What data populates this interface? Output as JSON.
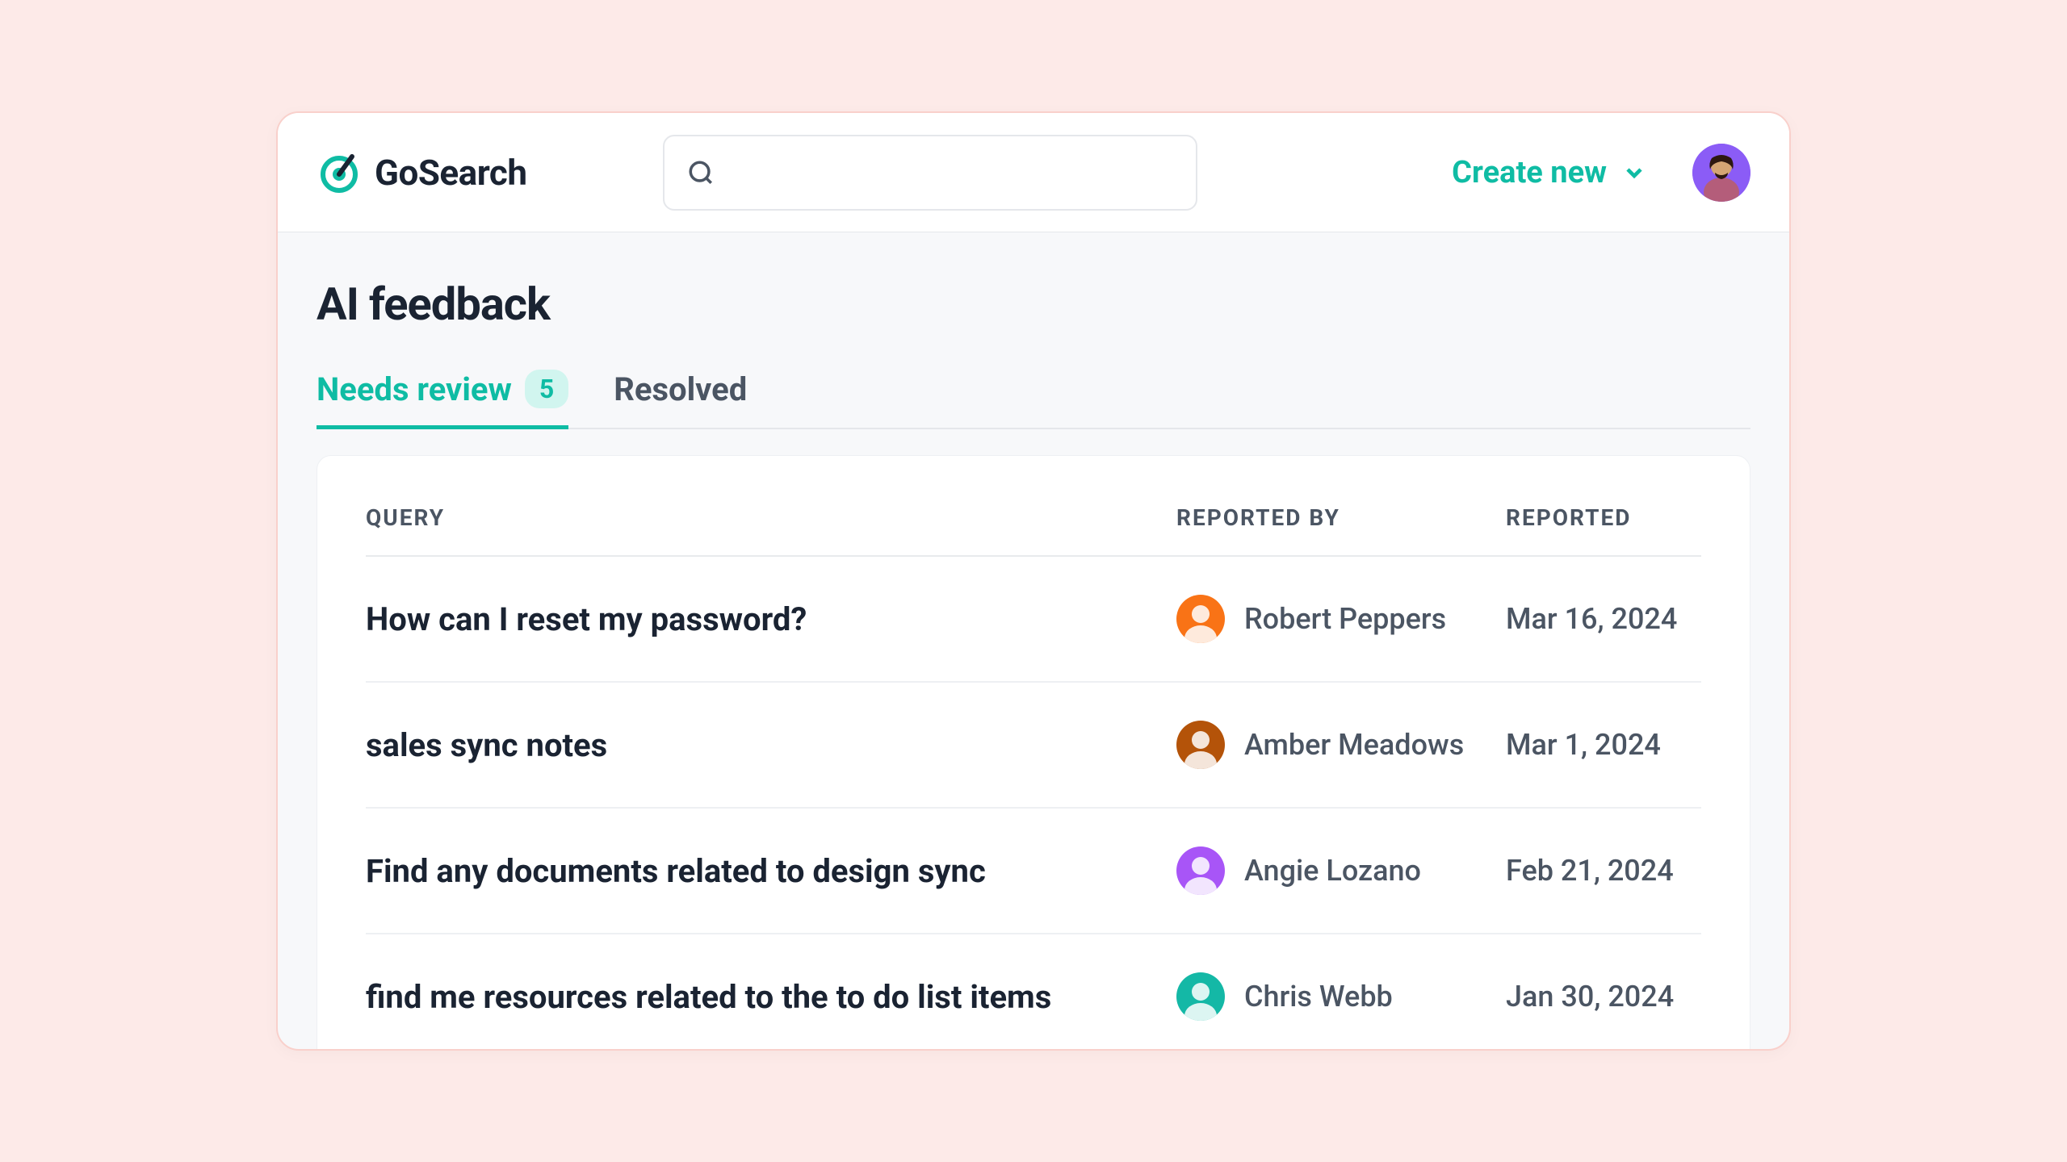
{
  "brand": {
    "name": "GoSearch"
  },
  "header": {
    "create_new_label": "Create new"
  },
  "page": {
    "title": "AI feedback"
  },
  "tabs": {
    "needs_review": {
      "label": "Needs review",
      "count": "5"
    },
    "resolved": {
      "label": "Resolved"
    }
  },
  "table": {
    "columns": {
      "query": "QUERY",
      "reported_by": "REPORTED BY",
      "reported": "REPORTED"
    },
    "rows": [
      {
        "query": "How can I reset my password?",
        "reporter": "Robert Peppers",
        "date": "Mar 16, 2024",
        "avatar_color": "#f97316"
      },
      {
        "query": "sales sync notes",
        "reporter": "Amber Meadows",
        "date": "Mar 1, 2024",
        "avatar_color": "#b45309"
      },
      {
        "query": "Find any documents related to design sync",
        "reporter": "Angie Lozano",
        "date": "Feb 21, 2024",
        "avatar_color": "#a855f7"
      },
      {
        "query": "find me resources related to the to do list items",
        "reporter": "Chris Webb",
        "date": "Jan 30, 2024",
        "avatar_color": "#14b8a6"
      }
    ]
  }
}
